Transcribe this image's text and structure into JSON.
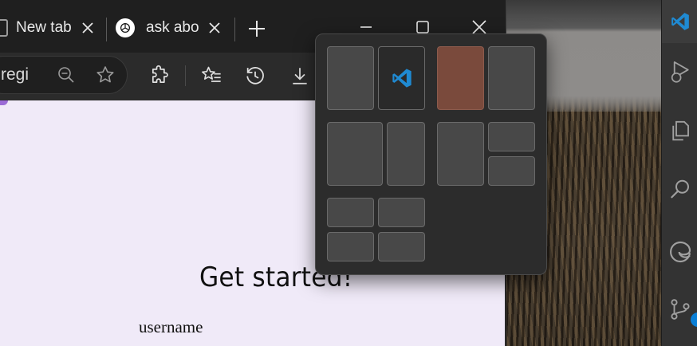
{
  "browser": {
    "tabs": [
      {
        "label": "New tab",
        "icon": "page-icon"
      },
      {
        "label": "ask abo",
        "icon": "openai-icon"
      }
    ],
    "address_text": "regi",
    "toolbar_icons": [
      "zoom-out-icon",
      "favorite-star-icon",
      "extensions-icon",
      "favorites-list-icon",
      "history-icon",
      "download-icon"
    ],
    "window_controls": [
      "minimize-icon",
      "maximize-icon",
      "close-icon"
    ]
  },
  "page": {
    "heading": "Get started!",
    "username_label": "username"
  },
  "snap_layouts": {
    "groups": [
      {
        "name": "two-column-halves",
        "zones": 2,
        "selected_zone": null,
        "app_icon": "vscode-icon"
      },
      {
        "name": "two-column-halves-alt",
        "zones": 2,
        "selected_zone": 0
      },
      {
        "name": "two-thirds-one-third",
        "zones": 2
      },
      {
        "name": "half-and-two-stacked",
        "zones": 3
      },
      {
        "name": "four-quadrants",
        "zones": 4
      }
    ],
    "selected_color": "#7a4a3c"
  },
  "vscode": {
    "activity_icons": [
      "vscode-logo-icon",
      "run-debug-icon",
      "explorer-icon",
      "search-icon",
      "edge-icon",
      "source-control-icon"
    ],
    "accent": "#0a7fd6"
  }
}
